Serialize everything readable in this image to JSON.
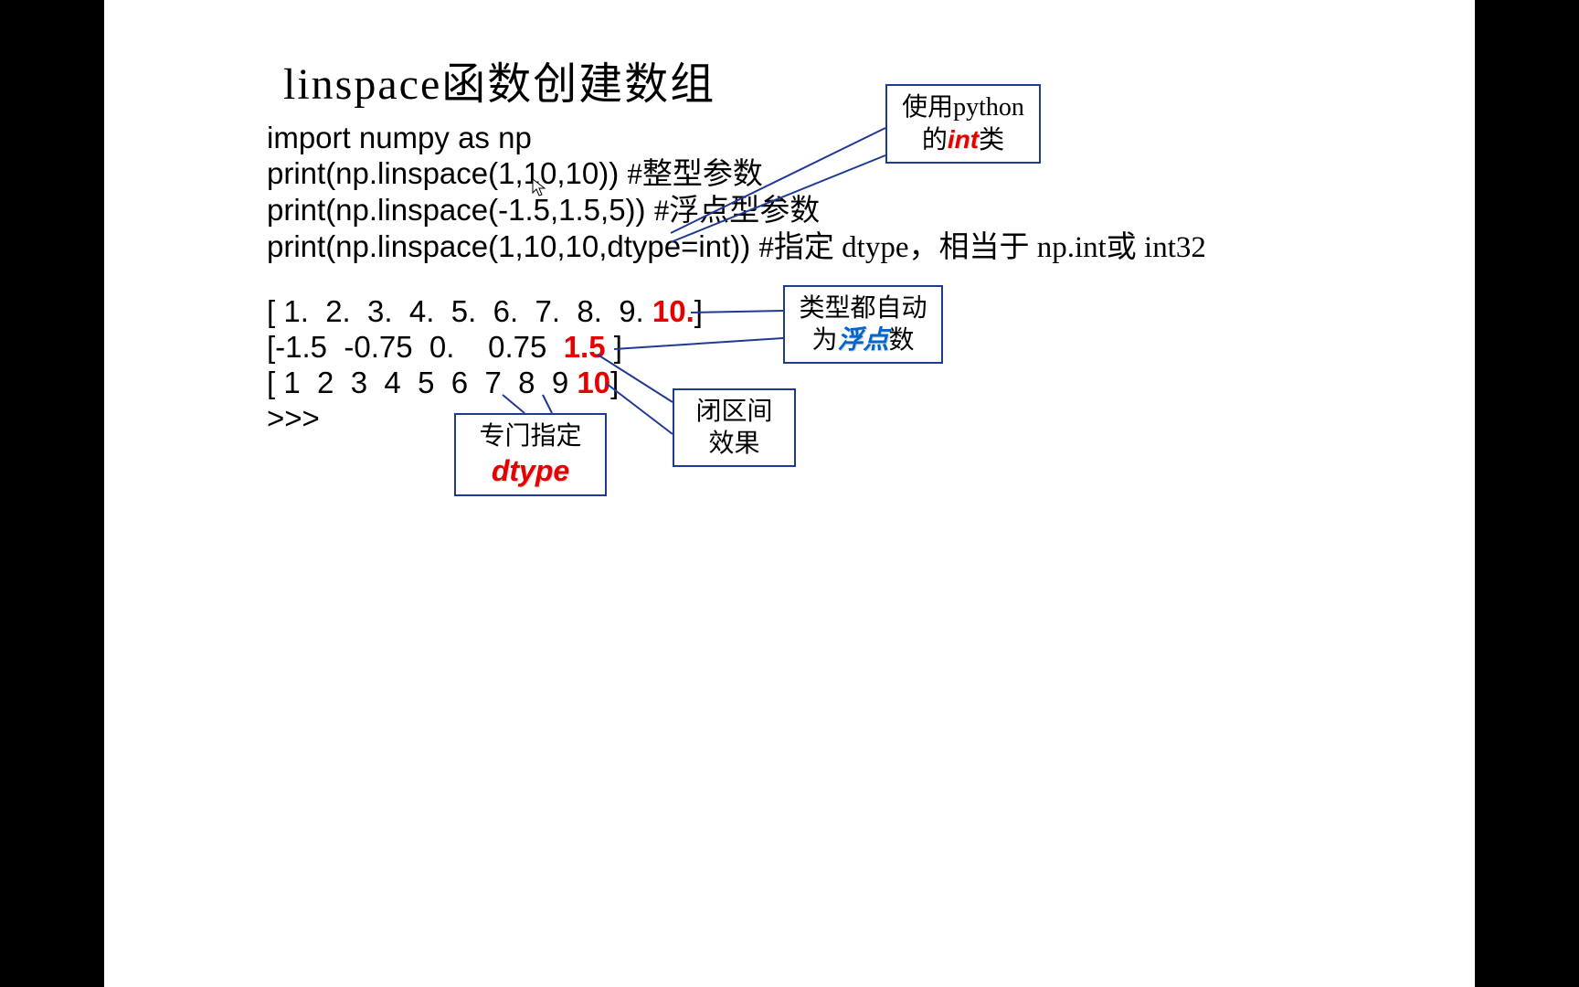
{
  "title": "linspace函数创建数组",
  "code": {
    "l1": "import numpy as np",
    "l2a": "print(np.linspace(1,10,10)) ",
    "l2b": "#整型参数",
    "l3a": "print(np.linspace(-1.5,1.5,5)) ",
    "l3b": "#浮点型参数",
    "l4a": "print(np.linspace(1,10,10,dtype=int)) ",
    "l4b": "#指定 dtype，相当于 np.int或 int32"
  },
  "output": {
    "r1a": "[ 1.  2.  3.  4.  5.  6.  7.  8.  9. ",
    "r1b": "10.",
    "r1c": "]",
    "r2a": "[-1.5  -0.75  0.    0.75  ",
    "r2b": "1.5",
    "r2c": " ]",
    "r3a": "[ 1  2  3  4  5  6  7  8  9 ",
    "r3b": "10",
    "r3c": "]",
    "r4": ">>>"
  },
  "callouts": {
    "int_pre": "使用python",
    "int_post1": "的",
    "int_hl": "int",
    "int_post2": "类",
    "float_pre": "类型都自动",
    "float_post1": "为",
    "float_hl": "浮点",
    "float_post2": "数",
    "closed_l1": "闭区间",
    "closed_l2": "效果",
    "dtype_l1": "专门指定",
    "dtype_hl": "dtype"
  }
}
